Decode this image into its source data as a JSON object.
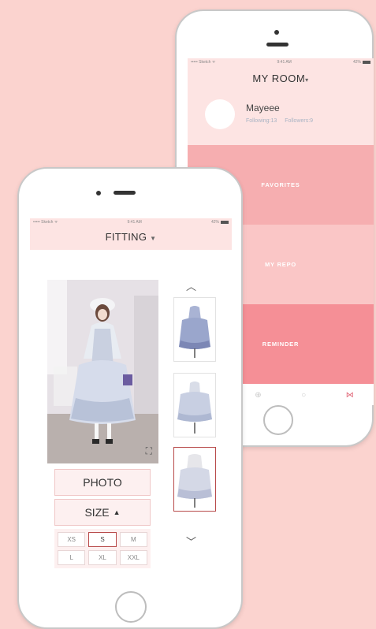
{
  "status_bar": {
    "carrier": "••••• Sketch ᯤ",
    "time": "9:41 AM",
    "battery": "42%"
  },
  "my_room": {
    "title": "MY ROOM",
    "user": {
      "name": "Mayeee",
      "following": "Following:13",
      "followers": "Followers:9"
    },
    "menu": [
      {
        "label": "FAVORITES",
        "color": "#f6aeb0"
      },
      {
        "label": "MY REPO",
        "color": "#fac6c6"
      },
      {
        "label": "REMINDER",
        "color": "#f58f96"
      }
    ],
    "tabbar": {
      "icons": [
        "list-icon",
        "plus-circle-icon",
        "search-icon",
        "bow-icon"
      ],
      "active": "bow-icon"
    }
  },
  "fitting": {
    "title": "FITTING",
    "photo_button": "PHOTO",
    "size_button": "SIZE",
    "sizes": [
      "XS",
      "S",
      "M",
      "L",
      "XL",
      "XXL"
    ],
    "selected_size": "S",
    "thumbnails": [
      "dress-thumb-1",
      "dress-thumb-2",
      "dress-thumb-3"
    ],
    "selected_thumbnail": 3
  },
  "colors": {
    "background": "#fbd3cf",
    "header_pink": "#fde4e3",
    "accent": "#b84a4a"
  }
}
